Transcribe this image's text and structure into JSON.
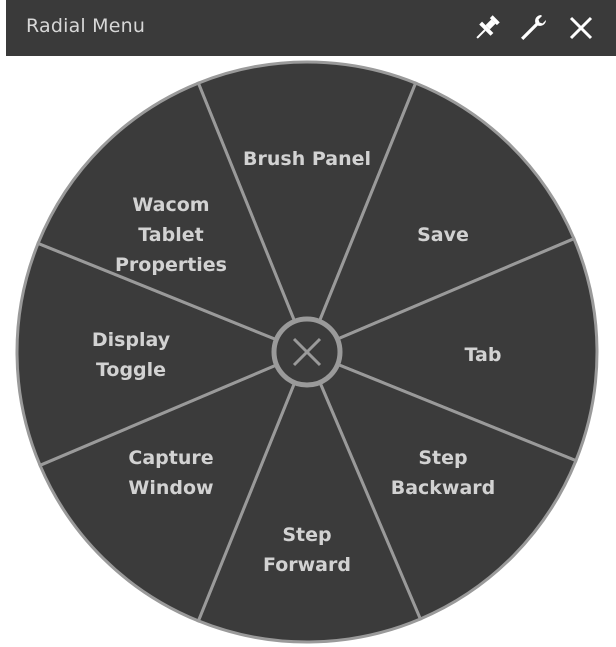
{
  "window": {
    "title": "Radial Menu",
    "buttons": [
      {
        "name": "pin",
        "icon": "pin-icon"
      },
      {
        "name": "settings",
        "icon": "wrench-icon"
      },
      {
        "name": "close",
        "icon": "close-icon"
      }
    ]
  },
  "menu": {
    "items": [
      {
        "id": "brush-panel",
        "lines": [
          "Brush Panel"
        ]
      },
      {
        "id": "save",
        "lines": [
          "Save"
        ]
      },
      {
        "id": "tab",
        "lines": [
          "Tab"
        ]
      },
      {
        "id": "step-backward",
        "lines": [
          "Step",
          "Backward"
        ]
      },
      {
        "id": "step-forward",
        "lines": [
          "Step",
          "Forward"
        ]
      },
      {
        "id": "capture-window",
        "lines": [
          "Capture",
          "Window"
        ]
      },
      {
        "id": "display-toggle",
        "lines": [
          "Display",
          "Toggle"
        ]
      },
      {
        "id": "wacom-tablet-properties",
        "lines": [
          "Wacom",
          "Tablet",
          "Properties"
        ]
      }
    ],
    "center_icon": "close-icon"
  },
  "colors": {
    "background": "#ffffff",
    "titlebar": "#3a3a3a",
    "title_text": "#d7d7d7",
    "wedge_fill": "#3b3b3b",
    "divider": "#9a9a9a",
    "label_text": "#d2d2d2",
    "icon": "#ffffff"
  }
}
